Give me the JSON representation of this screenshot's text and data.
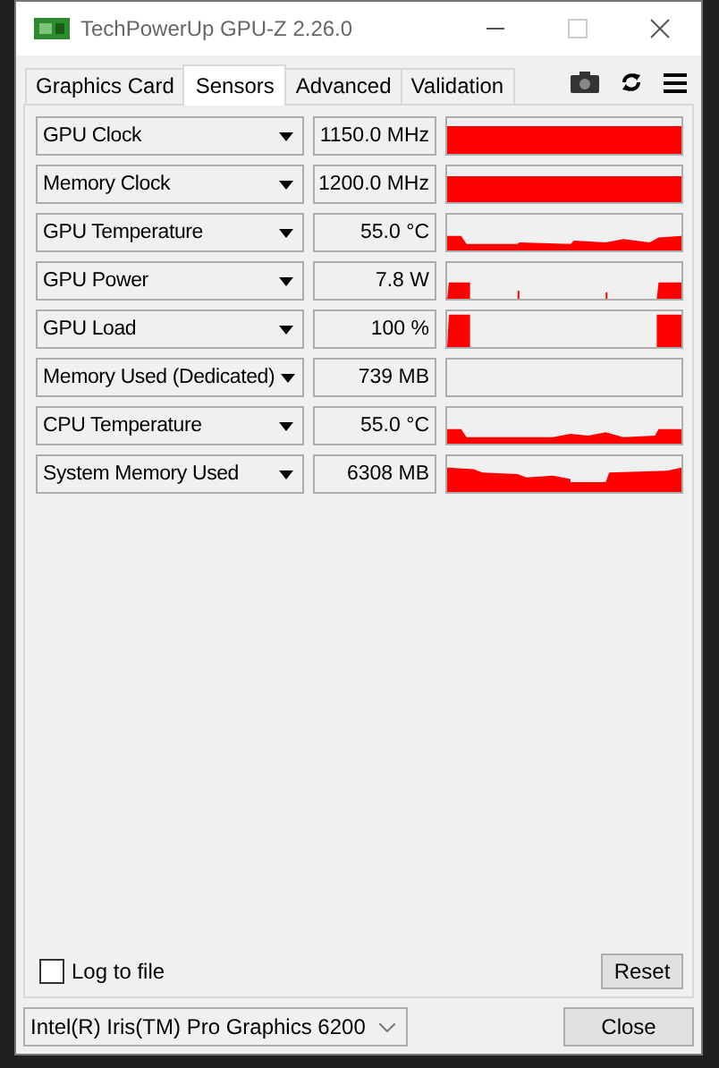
{
  "window": {
    "title": "TechPowerUp GPU-Z 2.26.0"
  },
  "tabs": [
    {
      "label": "Graphics Card",
      "selected": false
    },
    {
      "label": "Sensors",
      "selected": true
    },
    {
      "label": "Advanced",
      "selected": false
    },
    {
      "label": "Validation",
      "selected": false
    }
  ],
  "sensors": [
    {
      "name": "GPU Clock",
      "value": "1150.0 MHz"
    },
    {
      "name": "Memory Clock",
      "value": "1200.0 MHz"
    },
    {
      "name": "GPU Temperature",
      "value": "55.0 °C"
    },
    {
      "name": "GPU Power",
      "value": "7.8 W"
    },
    {
      "name": "GPU Load",
      "value": "100 %"
    },
    {
      "name": "Memory Used (Dedicated)",
      "value": "739 MB"
    },
    {
      "name": "CPU Temperature",
      "value": "55.0 °C"
    },
    {
      "name": "System Memory Used",
      "value": "6308 MB"
    }
  ],
  "log_to_file": {
    "label": "Log to file",
    "checked": false
  },
  "reset_button": "Reset",
  "gpu_select": {
    "value": "Intel(R) Iris(TM) Pro Graphics 6200"
  },
  "close_button": "Close"
}
